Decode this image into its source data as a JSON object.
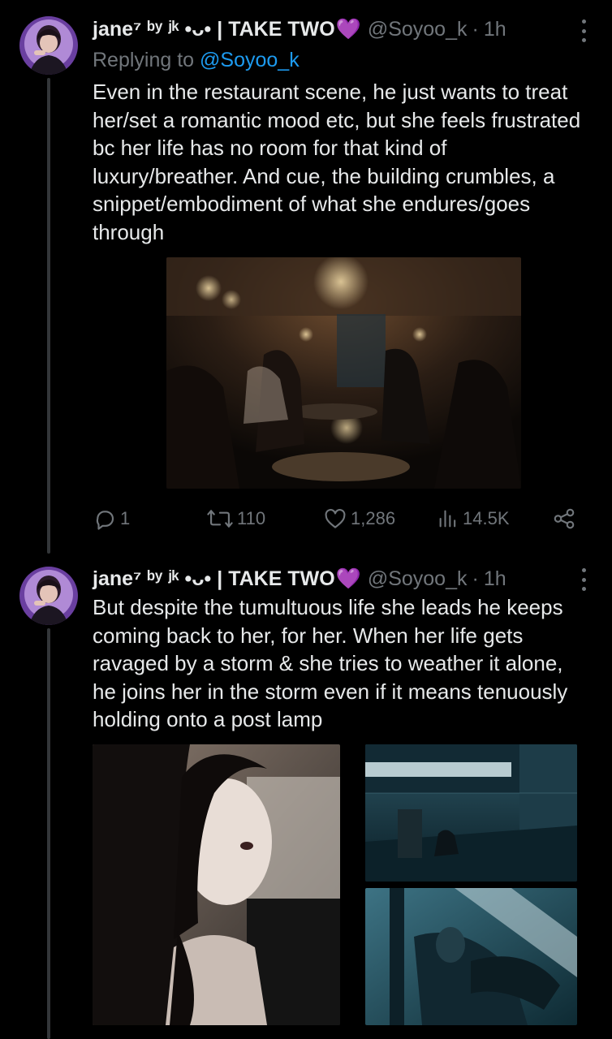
{
  "tweets": [
    {
      "display_name": "jane⁷ ᵇʸ ʲᵏ •ᴗ• | TAKE TWO",
      "heart": "💜",
      "handle": "@Soyoo_k",
      "separator": "·",
      "time": "1h",
      "replying_prefix": "Replying to",
      "replying_to": "@Soyoo_k",
      "text": "Even in the restaurant scene, he just wants to treat her/set a romantic mood etc, but she feels frustrated bc her life has no room for that kind of luxury/breather. And cue, the building crumbles, a snippet/embodiment of what she endures/goes through",
      "stats": {
        "replies": "1",
        "reposts": "110",
        "likes": "1,286",
        "views": "14.5K"
      }
    },
    {
      "display_name": "jane⁷ ᵇʸ ʲᵏ •ᴗ• | TAKE TWO",
      "heart": "💜",
      "handle": "@Soyoo_k",
      "separator": "·",
      "time": "1h",
      "text": "But despite the tumultuous life she leads he keeps coming back to her, for her. When her life gets ravaged by a storm & she tries to weather it alone, he joins her in the storm even if it means tenuously holding onto a post lamp"
    }
  ],
  "icons": {
    "avatar": "avatar-image",
    "more": "more-vertical-icon",
    "reply": "reply-icon",
    "repost": "repost-icon",
    "like": "heart-icon",
    "views": "views-chart-icon",
    "share": "share-icon"
  },
  "colors": {
    "background": "#000000",
    "text": "#e7e9ea",
    "muted": "#71767b",
    "link": "#1d9bf0",
    "heart": "#b44cff",
    "thread_line": "#333639"
  }
}
